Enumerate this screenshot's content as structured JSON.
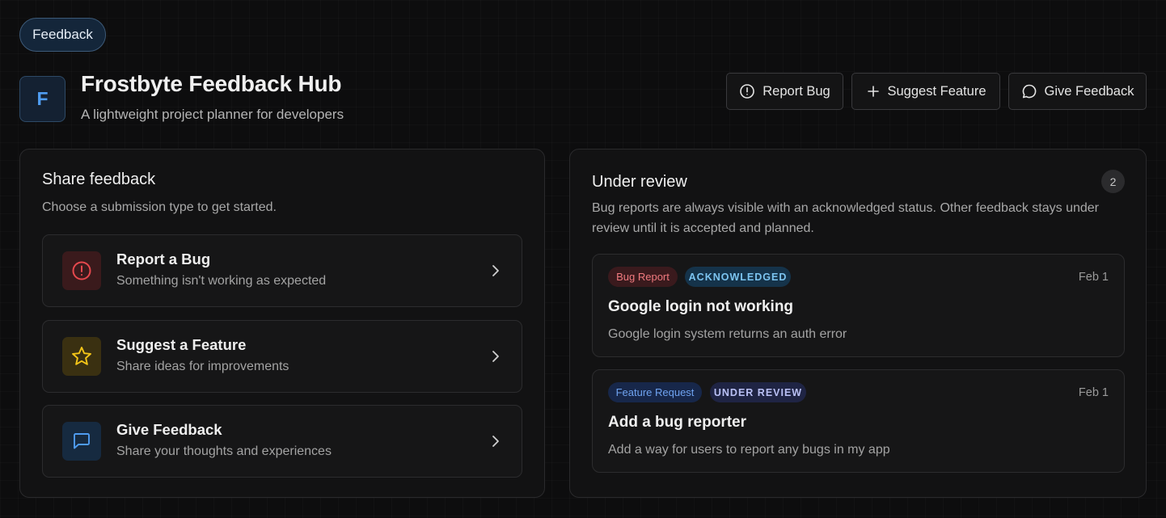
{
  "nav": {
    "feedback_pill": "Feedback"
  },
  "header": {
    "logo_letter": "F",
    "title": "Frostbyte Feedback Hub",
    "subtitle": "A lightweight project planner for developers",
    "buttons": {
      "report_bug": "Report Bug",
      "suggest_feature": "Suggest Feature",
      "give_feedback": "Give Feedback"
    }
  },
  "share": {
    "title": "Share feedback",
    "description": "Choose a submission type to get started.",
    "options": [
      {
        "title": "Report a Bug",
        "subtitle": "Something isn't working as expected",
        "icon": "alert-circle-icon",
        "color": "#e5484d"
      },
      {
        "title": "Suggest a Feature",
        "subtitle": "Share ideas for improvements",
        "icon": "star-icon",
        "color": "#f5c518"
      },
      {
        "title": "Give Feedback",
        "subtitle": "Share your thoughts and experiences",
        "icon": "message-square-icon",
        "color": "#4f9cf0"
      }
    ]
  },
  "review": {
    "title": "Under review",
    "count": "2",
    "description_line1": "Bug reports are always visible with an acknowledged status. Other feedback stays under",
    "description_line2": "review until it is accepted and planned.",
    "items": [
      {
        "type_tag": "Bug Report",
        "status_tag": "ACKNOWLEDGED",
        "date": "Feb 1",
        "title": "Google login not working",
        "description": "Google login system returns an auth error"
      },
      {
        "type_tag": "Feature Request",
        "status_tag": "UNDER REVIEW",
        "date": "Feb 1",
        "title": "Add a bug reporter",
        "description": "Add a way for users to report any bugs in my app"
      }
    ]
  },
  "colors": {
    "background": "#0d0d0e",
    "accent_blue": "#4f9cf0",
    "bug_red": "#e5484d",
    "feature_yellow": "#f5c518"
  }
}
